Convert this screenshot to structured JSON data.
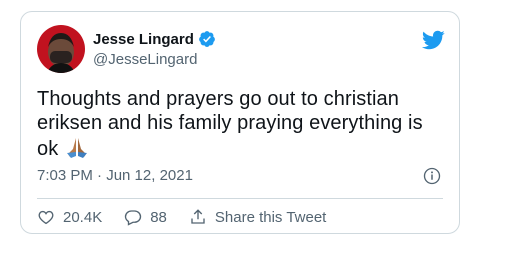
{
  "tweet": {
    "author_name": "Jesse Lingard",
    "author_handle": "@JesseLingard",
    "text": "Thoughts and prayers go out to christian eriksen and his family praying everything is ok",
    "timestamp": "7:03 PM · Jun 12, 2021",
    "verified": true
  },
  "actions": {
    "likes": "20.4K",
    "replies": "88",
    "share_label": "Share this Tweet"
  },
  "colors": {
    "brand": "#1d9bf0",
    "text_secondary": "#536471",
    "border": "#cfd9de"
  },
  "icons": {
    "brand": "twitter-bird-icon",
    "verified": "verified-badge-icon",
    "info": "info-icon",
    "like": "heart-icon",
    "reply": "reply-icon",
    "share": "share-icon",
    "emoji": "folded-hands-emoji"
  }
}
